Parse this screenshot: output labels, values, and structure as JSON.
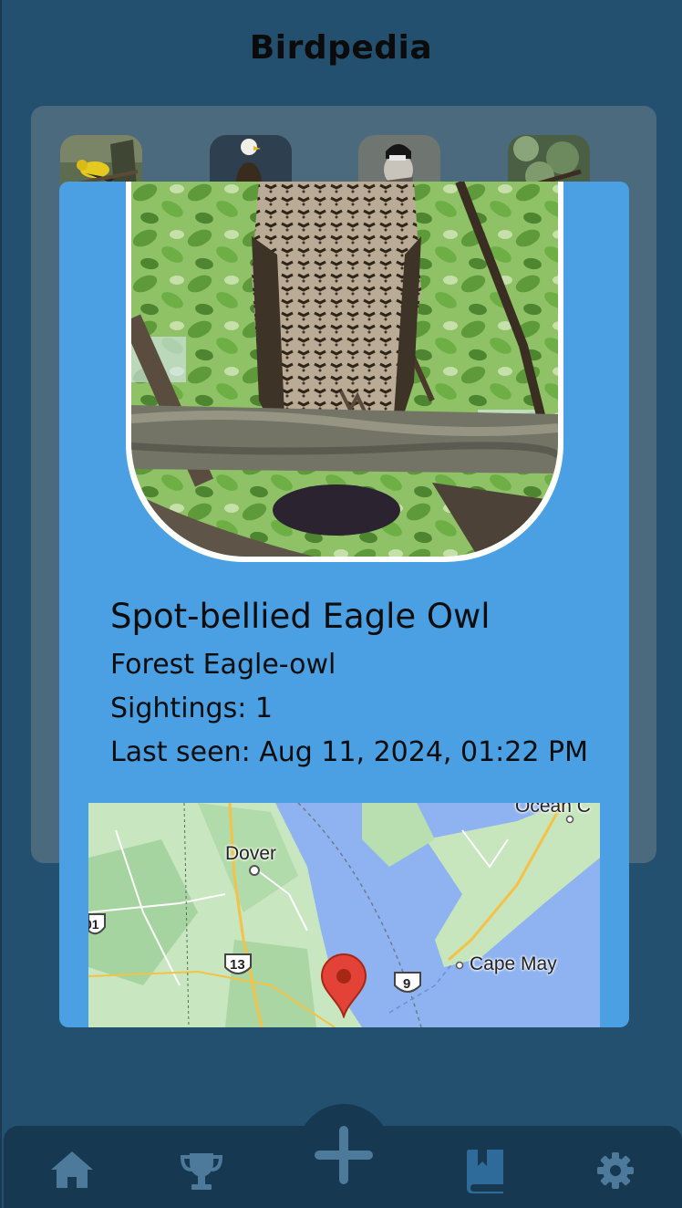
{
  "app": {
    "title": "Birdpedia"
  },
  "gallery": {
    "thumbnails": [
      {
        "name": "goldfinch"
      },
      {
        "name": "bald-eagle"
      },
      {
        "name": "chickadee"
      },
      {
        "name": "forest-bird"
      }
    ]
  },
  "detail": {
    "common_name": "Spot-bellied Eagle Owl",
    "alt_name": "Forest Eagle-owl",
    "sightings": "Sightings: 1",
    "last_seen": "Last seen: Aug 11, 2024, 01:22 PM"
  },
  "map": {
    "labels": {
      "dover": "Dover",
      "cape_may": "Cape May",
      "ocean": "Ocean C",
      "route_13": "13",
      "route_9": "9",
      "route_01": "01"
    },
    "pin_icon": "map-pin-icon"
  },
  "nav": {
    "items": [
      {
        "icon": "home-icon"
      },
      {
        "icon": "trophy-icon"
      },
      {
        "icon": "add-icon"
      },
      {
        "icon": "book-icon"
      },
      {
        "icon": "gear-icon"
      }
    ]
  },
  "colors": {
    "background": "#23506f",
    "card": "#4aa0e2",
    "panel": "#4c6a7d",
    "nav": "#163850",
    "nav_icon": "#4d7a9b",
    "nav_active": "#2e6b9b"
  }
}
